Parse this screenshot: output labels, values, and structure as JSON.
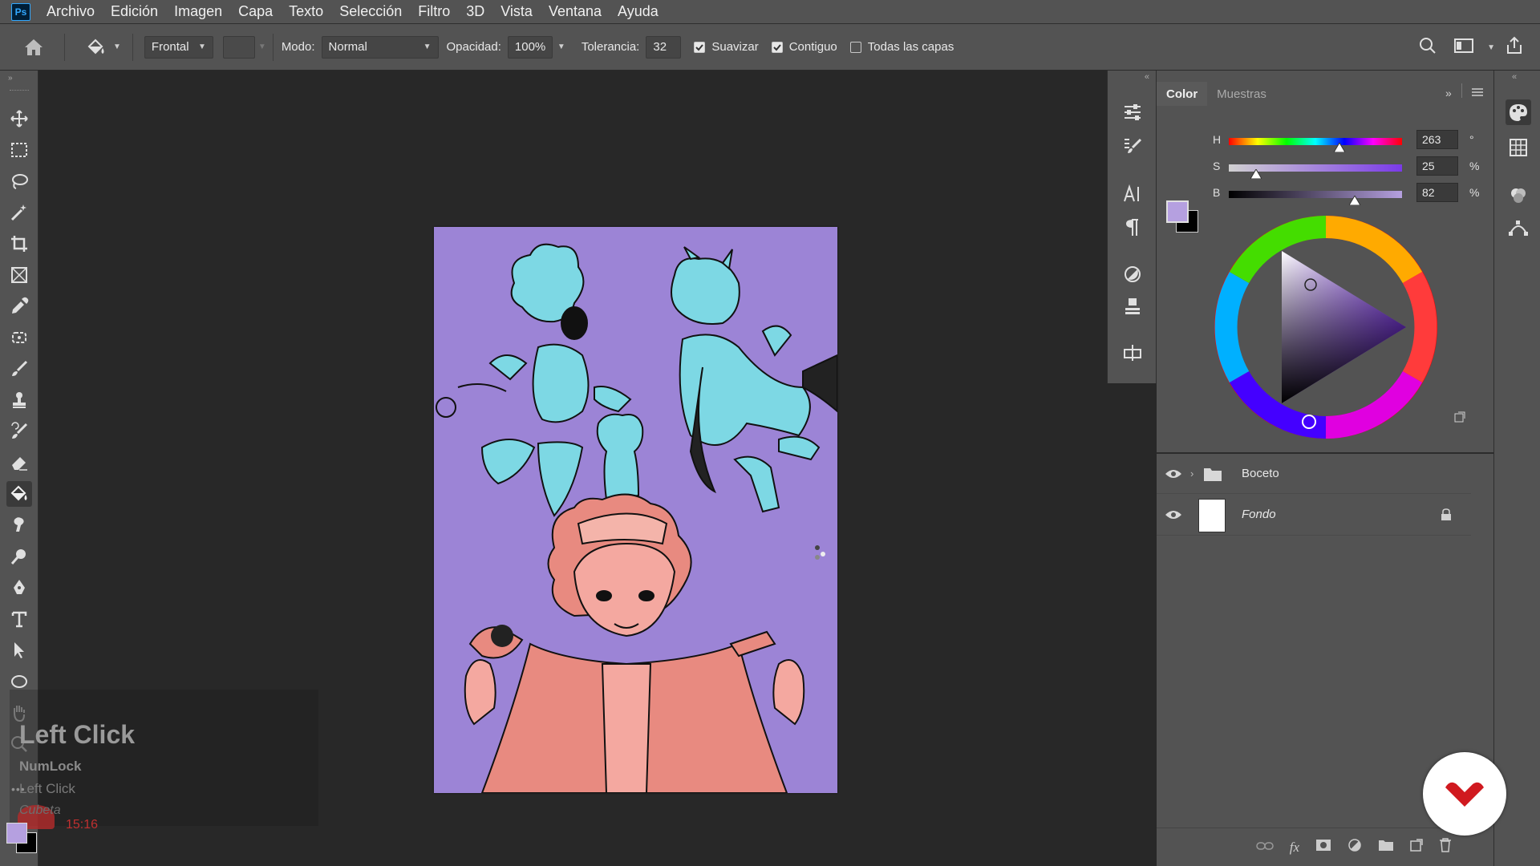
{
  "app": {
    "logo_text": "Ps"
  },
  "menubar": {
    "items": [
      "Archivo",
      "Edición",
      "Imagen",
      "Capa",
      "Texto",
      "Selección",
      "Filtro",
      "3D",
      "Vista",
      "Ventana",
      "Ayuda"
    ]
  },
  "options": {
    "fill_source": "Frontal",
    "mode_label": "Modo:",
    "mode_value": "Normal",
    "opacity_label": "Opacidad:",
    "opacity_value": "100%",
    "tolerance_label": "Tolerancia:",
    "tolerance_value": "32",
    "smooth_label": "Suavizar",
    "smooth_checked": true,
    "contiguous_label": "Contiguo",
    "contiguous_checked": true,
    "all_layers_label": "Todas las capas",
    "all_layers_checked": false
  },
  "tools": [
    "move-tool-icon",
    "marquee-tool-icon",
    "lasso-tool-icon",
    "magic-wand-tool-icon",
    "crop-tool-icon",
    "frame-tool-icon",
    "eyedropper-tool-icon",
    "patch-tool-icon",
    "brush-tool-icon",
    "stamp-tool-icon",
    "history-brush-tool-icon",
    "eraser-tool-icon",
    "paint-bucket-tool-icon",
    "blur-tool-icon",
    "dodge-tool-icon",
    "pen-tool-icon",
    "type-tool-icon",
    "path-selection-tool-icon",
    "ellipse-tool-icon",
    "hand-tool-icon",
    "zoom-tool-icon"
  ],
  "active_tool": "paint-bucket-tool-icon",
  "colors": {
    "foreground": "#b5a0e0",
    "background": "#000000",
    "canvas_bg": "#9c84d6"
  },
  "key_overlay": {
    "big": "Left Click",
    "mid": "NumLock",
    "small": "Left Click",
    "italic": "Cubeta",
    "time": "15:16"
  },
  "color_panel": {
    "tabs": [
      "Color",
      "Muestras"
    ],
    "h_label": "H",
    "h_value": "263",
    "h_unit": "°",
    "s_label": "S",
    "s_value": "25",
    "s_unit": "%",
    "b_label": "B",
    "b_value": "82",
    "b_unit": "%"
  },
  "layers": [
    {
      "name": "Boceto",
      "type": "group",
      "visible": true
    },
    {
      "name": "Fondo",
      "type": "background",
      "visible": true,
      "locked": true
    }
  ]
}
